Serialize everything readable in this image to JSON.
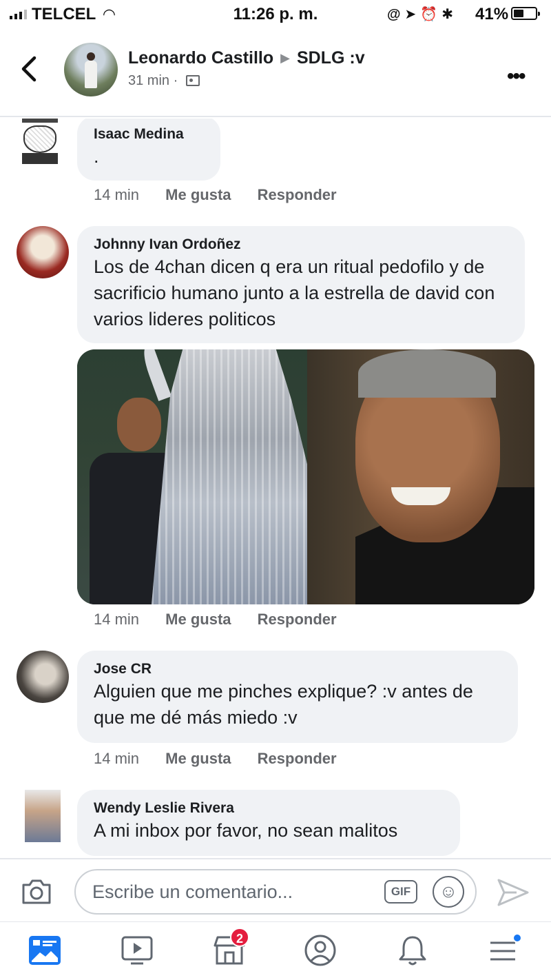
{
  "status_bar": {
    "carrier": "TELCEL",
    "time": "11:26 p. m.",
    "battery": "41%",
    "battery_level": 0.41,
    "icons": [
      "signal-icon",
      "wifi-icon",
      "at-icon",
      "location-icon",
      "alarm-icon",
      "bluetooth-icon",
      "battery-icon"
    ]
  },
  "header": {
    "author": "Leonardo Castillo",
    "group": "SDLG :v",
    "time": "31 min",
    "separator": "·",
    "icons": {
      "back": "chevron-left-icon",
      "more": "more-icon",
      "group": "group-icon"
    }
  },
  "comments": [
    {
      "author": "Isaac Medina",
      "text": ".",
      "time": "14 min",
      "like": "Me gusta",
      "reply": "Responder"
    },
    {
      "author": "Johnny Ivan Ordoñez",
      "text": "Los de 4chan dicen q era un ritual pedofilo y de sacrificio humano junto a la estrella de david con varios lideres politicos",
      "has_photo": true,
      "time": "14 min",
      "like": "Me gusta",
      "reply": "Responder"
    },
    {
      "author": "Jose CR",
      "text": "Alguien que me pinches explique? :v antes de que me dé más miedo :v",
      "time": "14 min",
      "like": "Me gusta",
      "reply": "Responder"
    },
    {
      "author": "Wendy Leslie Rivera",
      "text": "A mi inbox por favor, no sean malitos"
    }
  ],
  "composer": {
    "placeholder": "Escribe un comentario...",
    "gif": "GIF",
    "icons": {
      "camera": "camera-icon",
      "emoji": "emoji-icon",
      "send": "send-icon"
    }
  },
  "bottom_nav": {
    "items": [
      {
        "icon": "news-feed-icon",
        "active": true
      },
      {
        "icon": "watch-icon"
      },
      {
        "icon": "marketplace-icon",
        "badge": "2"
      },
      {
        "icon": "profile-icon"
      },
      {
        "icon": "notifications-icon"
      },
      {
        "icon": "menu-icon",
        "dot": true
      }
    ]
  },
  "colors": {
    "accent": "#1877f2",
    "bubble": "#f0f2f5",
    "badge": "#e41e3f",
    "meta": "#65676b"
  }
}
